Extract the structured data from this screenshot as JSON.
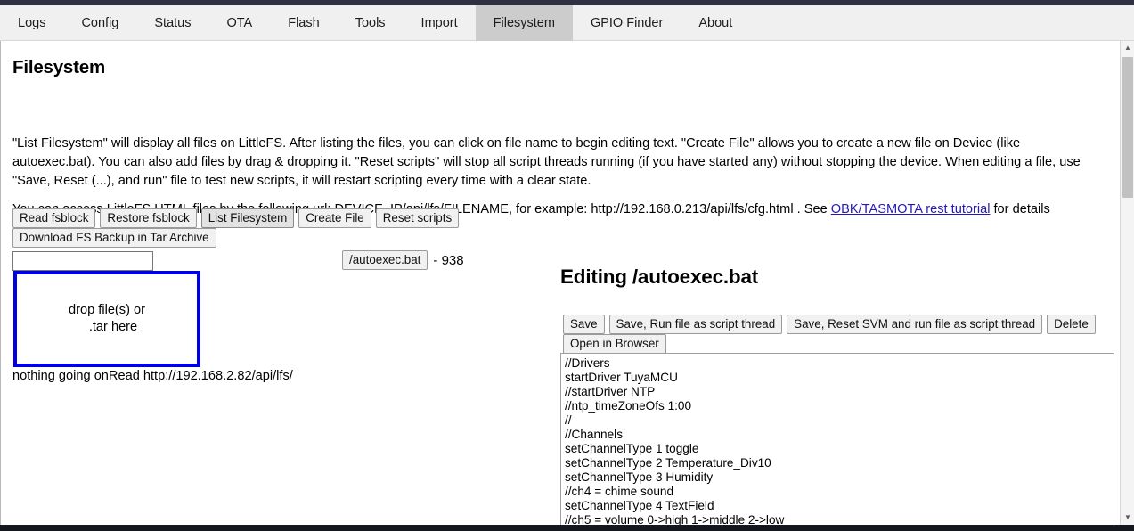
{
  "nav": {
    "tabs": [
      {
        "label": "Logs",
        "active": false
      },
      {
        "label": "Config",
        "active": false
      },
      {
        "label": "Status",
        "active": false
      },
      {
        "label": "OTA",
        "active": false
      },
      {
        "label": "Flash",
        "active": false
      },
      {
        "label": "Tools",
        "active": false
      },
      {
        "label": "Import",
        "active": false
      },
      {
        "label": "Filesystem",
        "active": true
      },
      {
        "label": "GPIO Finder",
        "active": false
      },
      {
        "label": "About",
        "active": false
      }
    ]
  },
  "main": {
    "title": "Filesystem",
    "paragraph1": "\"List Filesystem\" will display all files on LittleFS. After listing the files, you can click on file name to begin editing text. \"Create File\" allows you to create a new file on Device (like autoexec.bat). You can also add files by drag & dropping it. \"Reset scripts\" will stop all script threads running (if you have started any) without stopping the device. When editing a file, use \"Save, Reset (...), and run\" file to test new scripts, it will restart scripting every time with a clear state.",
    "paragraph2_before": "You can access LittleFS HTML files by the following url: DEVICE_IP/api/lfs/FILENAME, for example: http://192.168.0.213/api/lfs/cfg.html . See ",
    "paragraph2_link": "OBK/TASMOTA rest tutorial",
    "paragraph2_after": " for details",
    "action_buttons_row1": [
      {
        "label": "Read fsblock",
        "focused": false
      },
      {
        "label": "Restore fsblock",
        "focused": false
      },
      {
        "label": "List Filesystem",
        "focused": true
      },
      {
        "label": "Create File",
        "focused": false
      },
      {
        "label": "Reset scripts",
        "focused": false
      }
    ],
    "action_buttons_row2": [
      {
        "label": "Download FS Backup in Tar Archive",
        "focused": false
      }
    ],
    "filename_input": {
      "value": "",
      "placeholder": ""
    },
    "file_entry": {
      "name": "/autoexec.bat",
      "size_text": "- 938"
    },
    "dropzone": {
      "line1": "drop file(s) or",
      "line2": ".tar here"
    },
    "status_text": "nothing going onRead http://192.168.2.82/api/lfs/"
  },
  "editor": {
    "title": "Editing /autoexec.bat",
    "buttons_row1": [
      {
        "label": "Save"
      },
      {
        "label": "Save, Run file as script thread"
      },
      {
        "label": "Save, Reset SVM and run file as script thread"
      },
      {
        "label": "Delete"
      }
    ],
    "buttons_row2": [
      {
        "label": "Open in Browser"
      }
    ],
    "content": "//Drivers\nstartDriver TuyaMCU\n//startDriver NTP\n//ntp_timeZoneOfs 1:00\n//\n//Channels\nsetChannelType 1 toggle\nsetChannelType 2 Temperature_Div10\nsetChannelType 3 Humidity\n//ch4 = chime sound\nsetChannelType 4 TextField\n//ch5 = volume 0->high 1->middle 2->low"
  },
  "scrollbar": {
    "up_arrow": "chevron-up-icon",
    "down_arrow": "chevron-down-icon"
  },
  "colors": {
    "top_chrome": "#2e3142",
    "bottom_chrome": "#15171f",
    "active_tab": "#cccccc",
    "dropzone_border": "#0000e0",
    "link": "#2418b8"
  }
}
